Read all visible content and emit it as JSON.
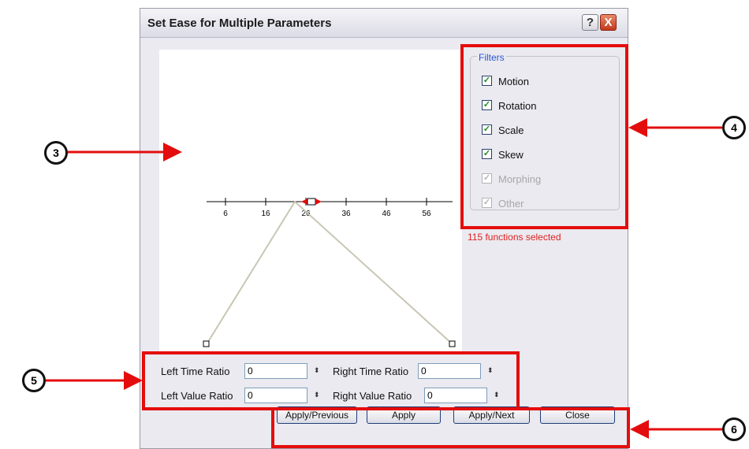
{
  "dialog": {
    "title": "Set Ease for Multiple Parameters",
    "help_icon": "?",
    "close_icon": "X"
  },
  "curve": {
    "ticks": [
      "6",
      "16",
      "26",
      "36",
      "46",
      "56"
    ],
    "keyframe_at": "26",
    "curve_color": "#c9c6b4"
  },
  "filters": {
    "legend": "Filters",
    "items": [
      {
        "label": "Motion",
        "checked": true,
        "enabled": true
      },
      {
        "label": "Rotation",
        "checked": true,
        "enabled": true
      },
      {
        "label": "Scale",
        "checked": true,
        "enabled": true
      },
      {
        "label": "Skew",
        "checked": true,
        "enabled": true
      },
      {
        "label": "Morphing",
        "checked": true,
        "enabled": false
      },
      {
        "label": "Other",
        "checked": true,
        "enabled": false
      }
    ],
    "count_text": "115 functions selected"
  },
  "ratios": {
    "left_time": {
      "label": "Left Time Ratio",
      "value": "0"
    },
    "right_time": {
      "label": "Right Time Ratio",
      "value": "0"
    },
    "left_value": {
      "label": "Left Value Ratio",
      "value": "0"
    },
    "right_value": {
      "label": "Right Value Ratio",
      "value": "0"
    },
    "spin_icon": "⬍"
  },
  "buttons": {
    "apply_previous": "Apply/Previous",
    "apply": "Apply",
    "apply_next": "Apply/Next",
    "close": "Close"
  },
  "callouts": [
    "3",
    "4",
    "5",
    "6"
  ],
  "annotation_color": "#e40d0d"
}
